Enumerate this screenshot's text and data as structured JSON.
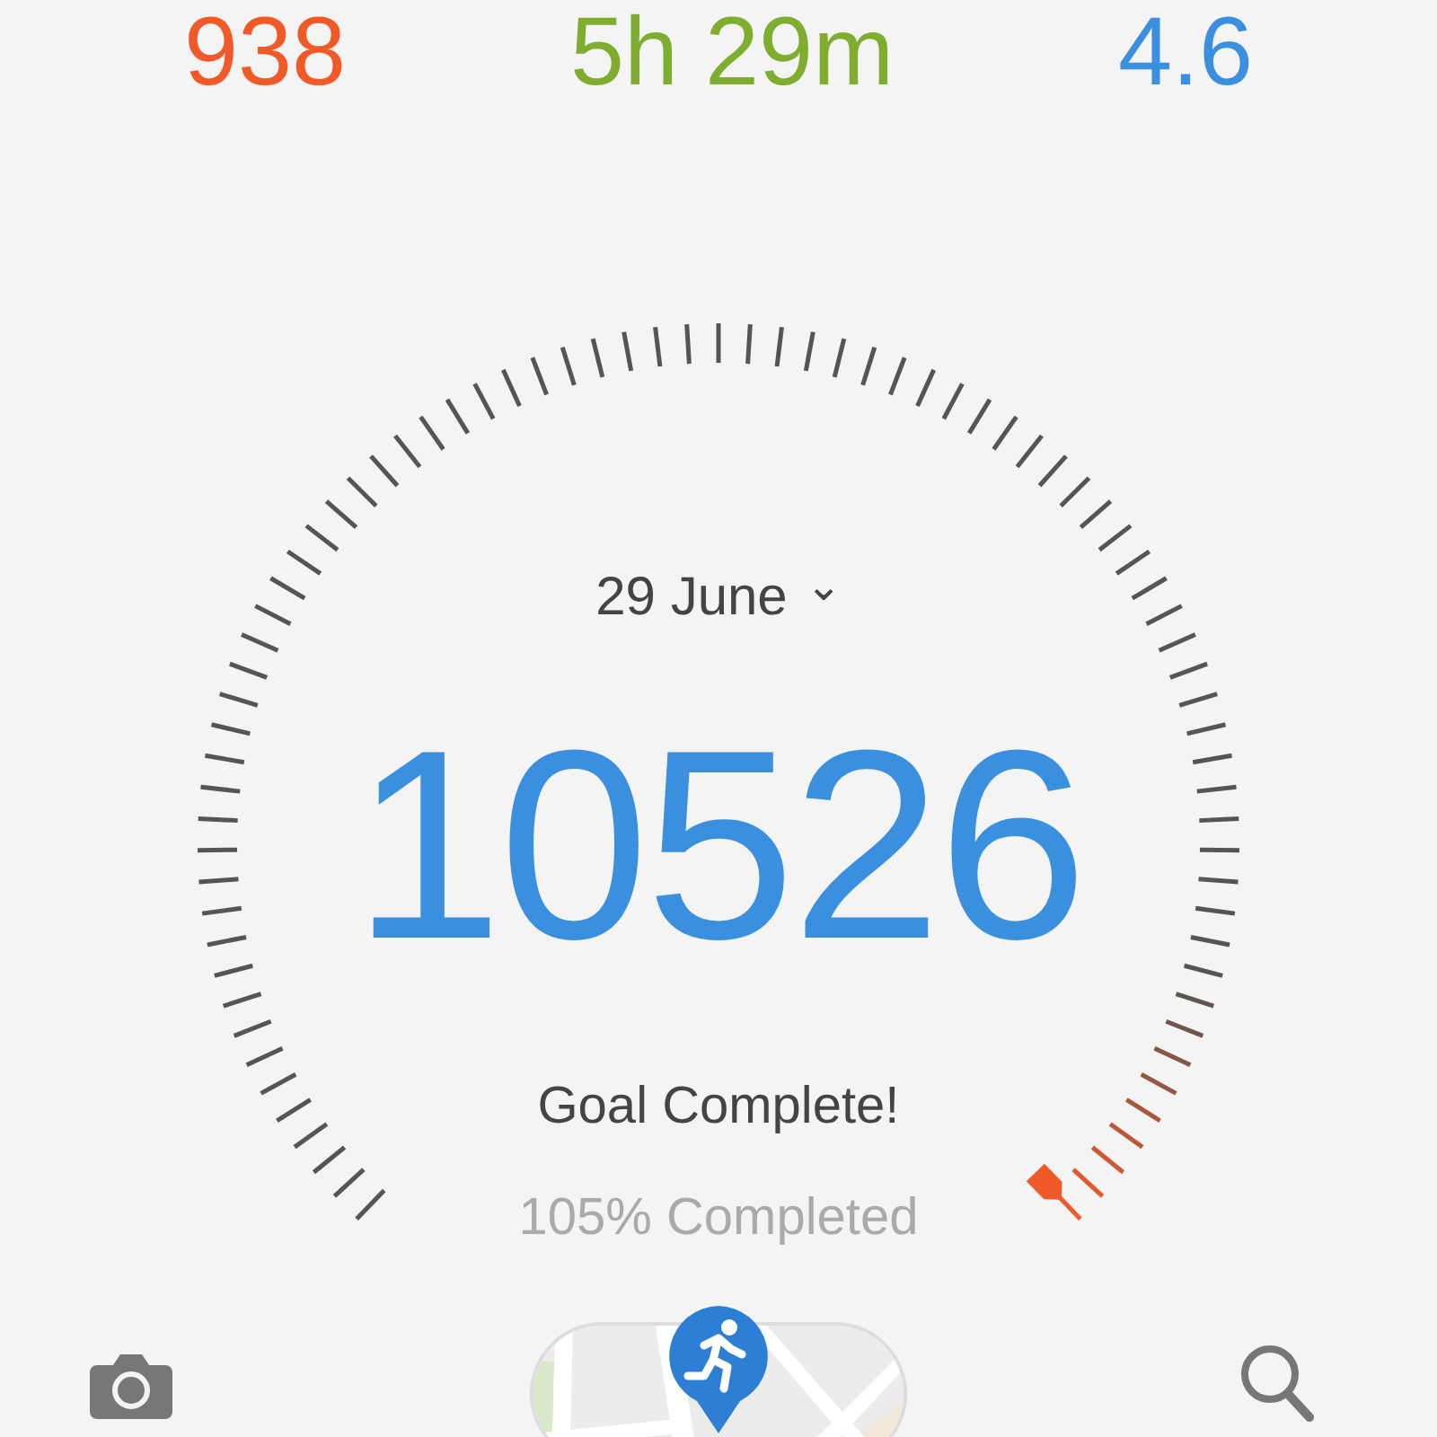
{
  "summary": [
    {
      "value": "938",
      "color": "#f05a28"
    },
    {
      "value": "5h 29m",
      "color": "#7fad2f"
    },
    {
      "value": "4.6",
      "color": "#3a8fde"
    }
  ],
  "date": {
    "label": "29 June",
    "caret": "⌄"
  },
  "steps": "10526",
  "status": "Goal Complete!",
  "progress": "105% Completed"
}
